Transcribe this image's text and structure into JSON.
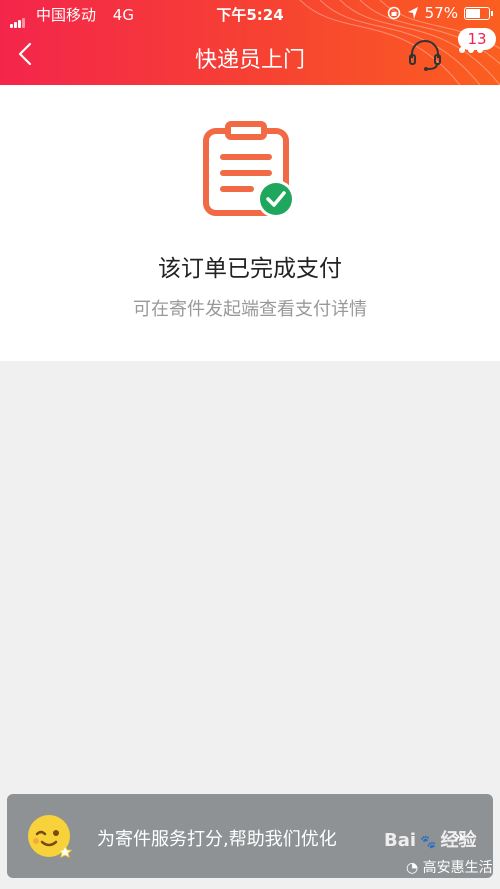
{
  "status_bar": {
    "carrier": "中国移动",
    "network": "4G",
    "time": "下午5:24",
    "battery": "57%"
  },
  "nav": {
    "title": "快递员上门",
    "badge_count": "13"
  },
  "order_card": {
    "title": "该订单已完成支付",
    "subtitle": "可在寄件发起端查看支付详情"
  },
  "rating_bar": {
    "text": "为寄件服务打分,帮助我们优化",
    "arrows": "»"
  },
  "watermark": {
    "brand": "Bai",
    "brand2": "经验",
    "account": "高安惠生活"
  },
  "colors": {
    "header_start": "#f4254b",
    "header_end": "#fb5f1f",
    "icon_orange": "#f26a45",
    "check_green": "#1fa85d"
  }
}
